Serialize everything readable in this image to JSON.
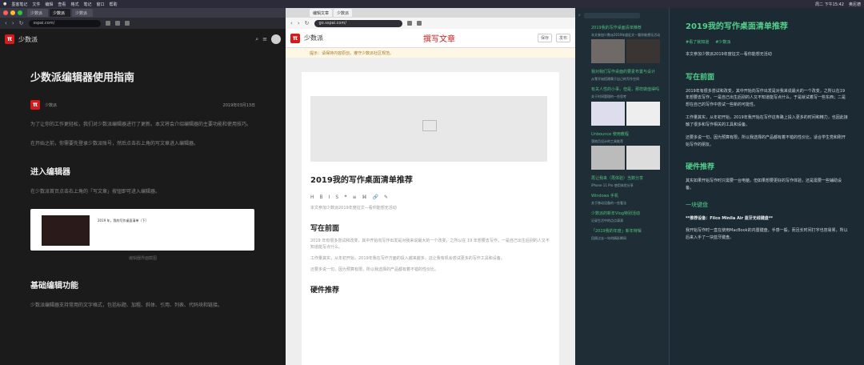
{
  "menubar": {
    "app": "墨客笔记",
    "items": [
      "文件",
      "编辑",
      "查看",
      "格式",
      "笔记",
      "窗口",
      "帮助"
    ],
    "clock": "周二 下午15:42",
    "user": "奥尼德"
  },
  "left": {
    "tabs": [
      "少数派",
      "少数派",
      "少数派"
    ],
    "address": "sspai.com/",
    "brand": "少数派",
    "title": "少数派编辑器使用指南",
    "author": "少数派",
    "date": "2019年03月13日",
    "para1": "为了让你的工作更轻松，我们对少数派编辑器进行了更新。本文将会介绍编辑器的主要功能和使用技巧。",
    "para2": "在开始之前，你需要先登录少数派账号，然后点击右上角的写文章进入编辑器。",
    "section1": "进入编辑器",
    "section1_text": "在少数派首页点击右上角的「写文章」按钮即可进入编辑器。",
    "shot_text": "2019 年，我的写作桌面清单（下）",
    "caption": "编辑器界面截图",
    "section2": "基础编辑功能",
    "section2_text": "少数派编辑器支持常用的文字格式，包括标题、加粗、斜体、引用、列表、代码块和链接。"
  },
  "mid": {
    "tabs": [
      "编辑文章",
      "少数派"
    ],
    "address": "go.sspai.com/",
    "brand": "少数派",
    "write_title": "撰写文章",
    "btn_save": "保存",
    "btn_publish": "发布",
    "notice": "提示：请保持内容原创，遵守少数派社区规范。",
    "article_title": "2019我的写作桌面清单推荐",
    "toolbar": [
      "H",
      "B",
      "I",
      "S",
      "❝",
      "≡",
      "⌘",
      "🔗",
      "✎"
    ],
    "intro": "本文参加少数派2019年度征文—看你能想无活动",
    "h_write": "写在前面",
    "body1": "2019 年有很多尝试和改变，其中开始向写作出发是对我来说最大的一个改变，之所以在 19 年想要去写作，一是自己出生后别的人又不知道能写点什么。",
    "body2": "工作量其实，从年初开始，2019年我在写作方面的投入越来越多，这让我有机会尝试更多的写作工具和设备。",
    "body3": "还要多说一句，因为预算有限，所以我选择的产品都有着不错的性价比。",
    "h_hard": "硬件推荐"
  },
  "right": {
    "items": [
      {
        "t": "2019我的写作桌面清单推荐",
        "d": "本文参加少数派2019年度征文—看你能想无活动"
      },
      {
        "t": "我对我们写作桌面的要素布置与设计",
        "d": "从零开始搭建属于自己的写作空间"
      },
      {
        "t": "有关人性的小事，但是，那样做值得吗",
        "d": "关于时间管理的一些思考"
      },
      {
        "t": "Unbounce 使用教程",
        "d": "落地页设计的工具推荐"
      },
      {
        "t": "再让我来（再体验）当数分享",
        "d": "iPhone 11 Pro 使用体验分享"
      },
      {
        "t": "Windows 手机",
        "d": "关于移动设备的一些看法"
      },
      {
        "t": "少数派的新年Vlog特别活动",
        "d": "记录生活中的点点滴滴"
      },
      {
        "t": "「2019我的年度」新年特辑",
        "d": "回顾过去一年的精彩瞬间"
      }
    ],
    "title": "2019我的写作桌面清单推荐",
    "tags": [
      "#看了就知道",
      "#少数派"
    ],
    "intro": "本文参加少数派2019年度征文—看你能想无活动",
    "h_write": "写在前面",
    "body1": "2019年有很多尝试和改变，其中开始向写作出发是对我来说最大的一个改变，之所以在19年想要去写作，一是自己出生后别的人又不知道能写点什么，于是就试着写一些东西；二是想在自己的写作中尝试一些新的可能性。",
    "body2": "工作量其实，从年初开始，2019年我开始在写作这条路上投入更多的时间和精力，也因此接触了很多和写作相关的工具和设备。",
    "body3": "还要多说一句，因为预算有限，所以我选择的产品都有着不错的性价比，适合学生党和刚开始写作的朋友。",
    "h_hard": "硬件推荐",
    "body4": "其实如果开始写作时只需要一台电脑，但如果想要更好的写作体验，还是需要一些辅助设备。",
    "h_kb": "一块键盘",
    "strong": "**推荐设备：Filco Minila Air 蓝牙无线键盘**",
    "body5": "我开始写作时一直在使用MacBook的内置键盘，手感一般，而且长时间打字也容易累，所以后来入手了一块蓝牙键盘。"
  }
}
